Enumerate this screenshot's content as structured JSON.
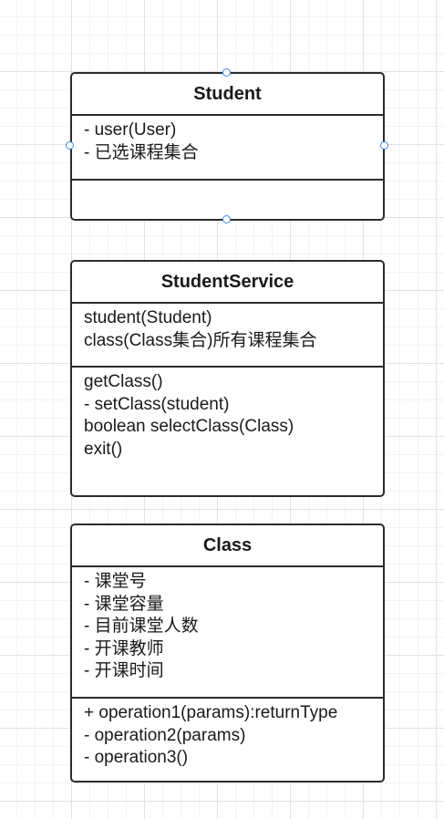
{
  "classes": [
    {
      "name": "Student",
      "attributes": [
        "- user(User)",
        "- 已选课程集合"
      ],
      "methods": []
    },
    {
      "name": "StudentService",
      "attributes": [
        "student(Student)",
        "class(Class集合)所有课程集合"
      ],
      "methods": [
        "getClass()",
        "- setClass(student)",
        "boolean selectClass(Class)",
        "exit()"
      ]
    },
    {
      "name": "Class",
      "attributes": [
        "- 课堂号",
        "- 课堂容量",
        "- 目前课堂人数",
        "- 开课教师",
        "- 开课时间"
      ],
      "methods": [
        "+ operation1(params):returnType",
        "- operation2(params)",
        "- operation3()"
      ]
    }
  ],
  "selection_color": "#3b8eea",
  "border_color": "#2b2b2b"
}
